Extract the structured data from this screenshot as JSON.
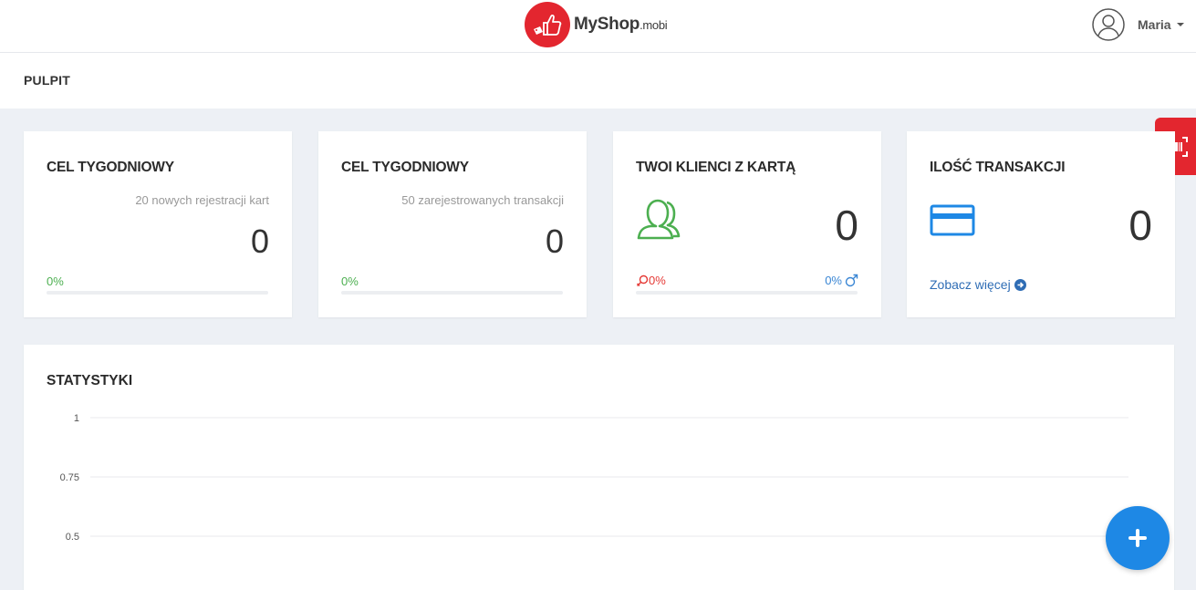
{
  "brand": {
    "name": "MyShop",
    "suffix": ".mobi",
    "color": "#e3262f"
  },
  "user": {
    "name": "Maria"
  },
  "page": {
    "title": "PULPIT"
  },
  "cards": [
    {
      "title": "CEL TYGODNIOWY",
      "subtitle": "20 nowych rejestracji kart",
      "value": "0",
      "percent": "0%"
    },
    {
      "title": "CEL TYGODNIOWY",
      "subtitle": "50 zarejestrowanych transakcji",
      "value": "0",
      "percent": "0%"
    },
    {
      "title": "TWOI KLIENCI Z KARTĄ",
      "value": "0",
      "female_percent": "0%",
      "male_percent": "0%",
      "icon": "users-icon"
    },
    {
      "title": "ILOŚĆ TRANSAKCJI",
      "value": "0",
      "link": "Zobacz więcej",
      "icon": "credit-card-icon"
    }
  ],
  "stats": {
    "title": "STATYSTYKI",
    "chart_data": {
      "type": "line",
      "y_ticks": [
        "1",
        "0.75",
        "0.5"
      ],
      "ylim": [
        0.5,
        1
      ],
      "grid": true
    }
  },
  "colors": {
    "accent": "#1e88e5",
    "success": "#4caf50",
    "female": "#e53935",
    "male": "#3a86d4"
  }
}
